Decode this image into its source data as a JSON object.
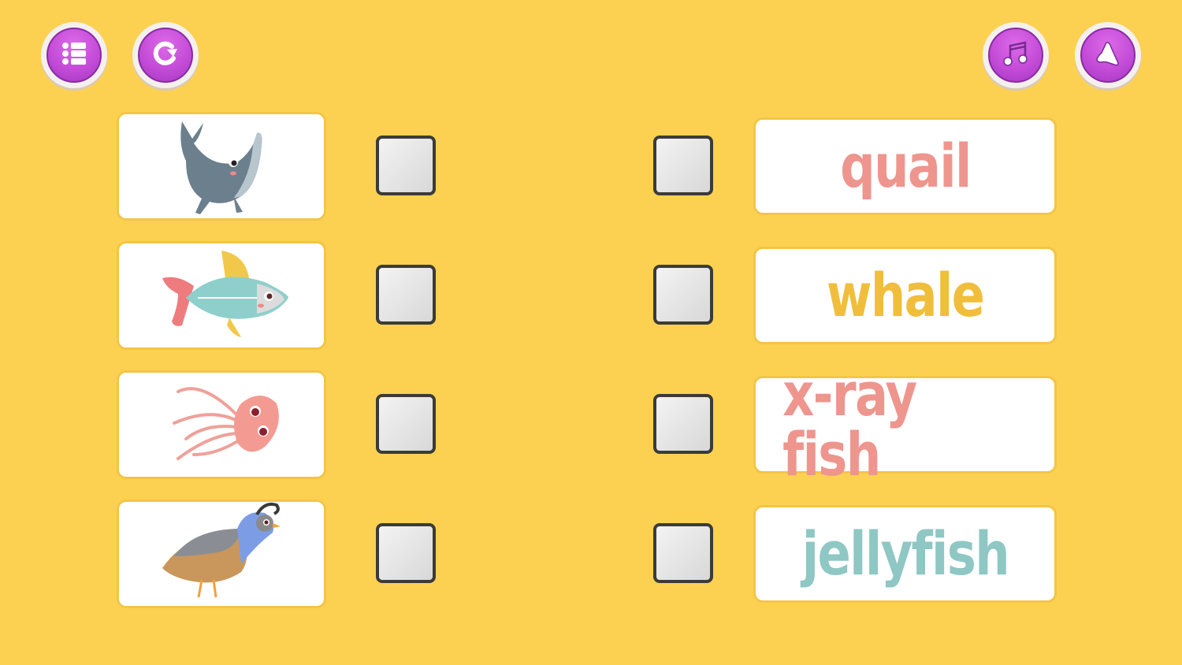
{
  "toolbar": {
    "left_buttons": [
      {
        "name": "menu",
        "icon": "list-icon"
      },
      {
        "name": "restart",
        "icon": "restart-icon"
      }
    ],
    "right_buttons": [
      {
        "name": "music",
        "icon": "music-note-icon"
      },
      {
        "name": "sound",
        "icon": "speaker-icon"
      }
    ],
    "button_color": "#c44cd8"
  },
  "game": {
    "background_color": "#fcd152",
    "pictures": [
      {
        "animal": "whale",
        "icon": "whale-icon",
        "checked": false
      },
      {
        "animal": "x-ray fish",
        "icon": "x-ray-fish-icon",
        "checked": false
      },
      {
        "animal": "jellyfish",
        "icon": "jellyfish-icon",
        "checked": false
      },
      {
        "animal": "quail",
        "icon": "quail-icon",
        "checked": false
      }
    ],
    "words": [
      {
        "label": "quail",
        "color": "#ee958e",
        "checked": false
      },
      {
        "label": "whale",
        "color": "#f0be3a",
        "checked": false
      },
      {
        "label": "x-ray fish",
        "color": "#ee958e",
        "checked": false
      },
      {
        "label": "jellyfish",
        "color": "#8ec7c3",
        "checked": false
      }
    ]
  }
}
